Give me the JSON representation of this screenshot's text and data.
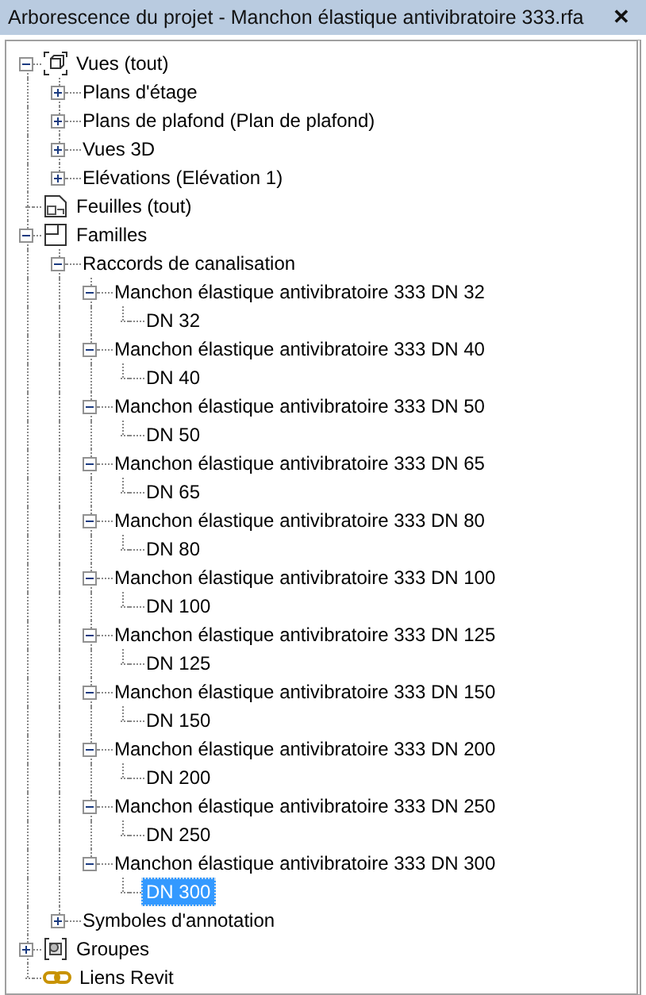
{
  "window": {
    "title": "Arborescence du projet - Manchon élastique antivibratoire 333.rfa",
    "close": "✕"
  },
  "tree": [
    {
      "label": "Vues (tout)",
      "kind": "views",
      "expanded": true,
      "selected": false,
      "children": [
        {
          "label": "Plans d'étage",
          "expanded": false,
          "selected": false
        },
        {
          "label": "Plans de plafond (Plan de plafond)",
          "expanded": false,
          "selected": false
        },
        {
          "label": "Vues 3D",
          "expanded": false,
          "selected": false
        },
        {
          "label": "Elévations (Elévation 1)",
          "expanded": false,
          "selected": false
        }
      ]
    },
    {
      "label": "Feuilles (tout)",
      "kind": "sheets",
      "selected": false
    },
    {
      "label": "Familles",
      "kind": "families",
      "expanded": true,
      "selected": false,
      "children": [
        {
          "label": "Raccords de canalisation",
          "expanded": true,
          "selected": false,
          "children": [
            {
              "label": "Manchon élastique antivibratoire 333 DN 32",
              "expanded": true,
              "selected": false,
              "children": [
                {
                  "label": "DN 32",
                  "selected": false
                }
              ]
            },
            {
              "label": "Manchon élastique antivibratoire 333 DN 40",
              "expanded": true,
              "selected": false,
              "children": [
                {
                  "label": "DN 40",
                  "selected": false
                }
              ]
            },
            {
              "label": "Manchon élastique antivibratoire 333 DN 50",
              "expanded": true,
              "selected": false,
              "children": [
                {
                  "label": "DN 50",
                  "selected": false
                }
              ]
            },
            {
              "label": "Manchon élastique antivibratoire 333 DN 65",
              "expanded": true,
              "selected": false,
              "children": [
                {
                  "label": "DN 65",
                  "selected": false
                }
              ]
            },
            {
              "label": "Manchon élastique antivibratoire 333 DN 80",
              "expanded": true,
              "selected": false,
              "children": [
                {
                  "label": "DN 80",
                  "selected": false
                }
              ]
            },
            {
              "label": "Manchon élastique antivibratoire 333 DN 100",
              "expanded": true,
              "selected": false,
              "children": [
                {
                  "label": "DN 100",
                  "selected": false
                }
              ]
            },
            {
              "label": "Manchon élastique antivibratoire 333 DN 125",
              "expanded": true,
              "selected": false,
              "children": [
                {
                  "label": "DN 125",
                  "selected": false
                }
              ]
            },
            {
              "label": "Manchon élastique antivibratoire 333 DN 150",
              "expanded": true,
              "selected": false,
              "children": [
                {
                  "label": "DN 150",
                  "selected": false
                }
              ]
            },
            {
              "label": "Manchon élastique antivibratoire 333 DN 200",
              "expanded": true,
              "selected": false,
              "children": [
                {
                  "label": "DN 200",
                  "selected": false
                }
              ]
            },
            {
              "label": "Manchon élastique antivibratoire 333 DN 250",
              "expanded": true,
              "selected": false,
              "children": [
                {
                  "label": "DN 250",
                  "selected": false
                }
              ]
            },
            {
              "label": "Manchon élastique antivibratoire 333 DN 300",
              "expanded": true,
              "selected": false,
              "children": [
                {
                  "label": "DN 300",
                  "selected": true
                }
              ]
            }
          ]
        },
        {
          "label": "Symboles d'annotation",
          "expanded": false,
          "selected": false
        }
      ]
    },
    {
      "label": "Groupes",
      "kind": "groups",
      "expanded": false,
      "selected": false
    },
    {
      "label": "Liens Revit",
      "kind": "links",
      "selected": false
    }
  ]
}
